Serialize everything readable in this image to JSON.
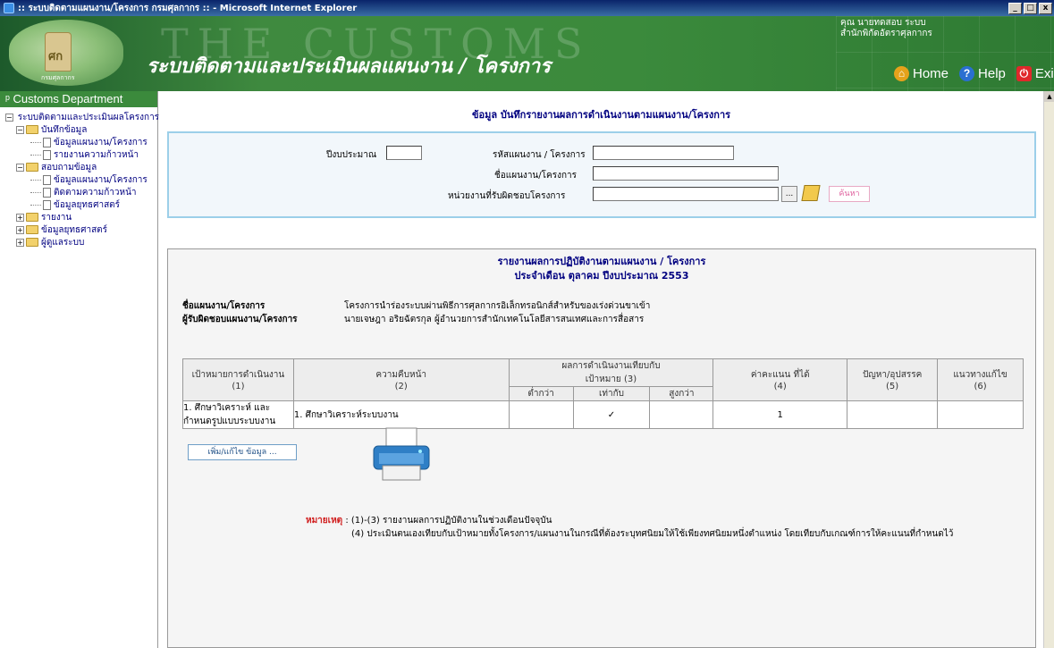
{
  "window": {
    "title": ":: ระบบติดตามแผนงาน/โครงการ กรมศุลกากร :: - Microsoft Internet Explorer",
    "min": "_",
    "max": "□",
    "close": "x"
  },
  "header": {
    "watermark": "THE CUSTOMS",
    "app_title": "ระบบติดตามและประเมินผลแผนงาน / โครงการ",
    "user_line1": "คุณ นายทดสอบ ระบบ",
    "user_line2": "สำนักพิกัดอัตราศุลกากร",
    "logo_caption": "กรมศุลกากร",
    "emblem_text": "ศก",
    "nav": {
      "home": "Home",
      "help": "Help",
      "exit": "Exit"
    }
  },
  "sidebar": {
    "header": "Customs Department",
    "root": "ระบบติดตามและประเมินผลโครงการ",
    "group1": "บันทึกข้อมูล",
    "item1": "ข้อมูลแผนงาน/โครงการ",
    "item2": "รายงานความก้าวหน้า",
    "group2": "สอบถามข้อมูล",
    "item3": "ข้อมูลแผนงาน/โครงการ",
    "item4": "ติดตามความก้าวหน้า",
    "item5": "ข้อมูลยุทธศาสตร์",
    "group3": "รายงาน",
    "group4": "ข้อมูลยุทธศาสตร์",
    "group5": "ผู้ดูแลระบบ"
  },
  "main": {
    "page_title": "ข้อมูล  บันทึกรายงานผลการดำเนินงานตามแผนงาน/โครงการ",
    "search": {
      "year_label": "ปีงบประมาณ",
      "code_label": "รหัสแผนงาน / โครงการ",
      "name_label": "ชื่อแผนงาน/โครงการ",
      "unit_label": "หน่วยงานที่รับผิดชอบโครงการ",
      "browse_button": "...",
      "search_button": "ค้นหา"
    },
    "report": {
      "title1": "รายงานผลการปฏิบัติงานตามแผนงาน / โครงการ",
      "title2": "ประจำเดือน ตุลาคม  ปีงบประมาณ 2553",
      "plan_label": "ชื่อแผนงาน/โครงการ",
      "plan_value": "โครงการนำร่องระบบผ่านพิธีการศุลกากรอิเล็กทรอนิกส์สำหรับของเร่งด่วนขาเข้า",
      "owner_label": "ผู้รับผิดชอบแผนงาน/โครงการ",
      "owner_value": "นายเจษฎา อริยฉัตรกุล ผู้อำนวยการสำนักเทคโนโลยีสารสนเทศและการสื่อสาร",
      "table": {
        "h1": "เป้าหมายการดำเนินงาน",
        "h1n": "(1)",
        "h2": "ความคืบหน้า",
        "h2n": "(2)",
        "h3": "ผลการดำเนินงานเทียบกับ",
        "h3b": "เป้าหมาย (3)",
        "h3_lower": "ต่ำกว่า",
        "h3_equal": "เท่ากับ",
        "h3_higher": "สูงกว่า",
        "h4": "ค่าคะแนน ที่ได้",
        "h4n": "(4)",
        "h5": "ปัญหา/อุปสรรค",
        "h5n": "(5)",
        "h6": "แนวทางแก้ไข",
        "h6n": "(6)",
        "row1": {
          "goal": "1. ศึกษาวิเคราะห์ และกำหนดรูปแบบระบบงาน",
          "progress": "1. ศึกษาวิเคราะห์ระบบงาน",
          "lower": "",
          "equal": "✓",
          "higher": "",
          "score": "1",
          "problem": "",
          "solution": ""
        }
      },
      "edit_button": "เพิ่ม/แก้ไข ข้อมูล ...",
      "note_label": "หมายเหตุ",
      "note1": " : (1)-(3) รายงานผลการปฏิบัติงานในช่วงเดือนปัจจุบัน",
      "note2": "(4) ประเมินตนเองเทียบกับเป้าหมายทั้งโครงการ/แผนงานในกรณีที่ต้องระบุทศนิยมให้ใช้เพียงทศนิยมหนึ่งตำแหน่ง โดยเทียบกับเกณฑ์การให้คะแนนที่กำหนดไว้"
    }
  }
}
